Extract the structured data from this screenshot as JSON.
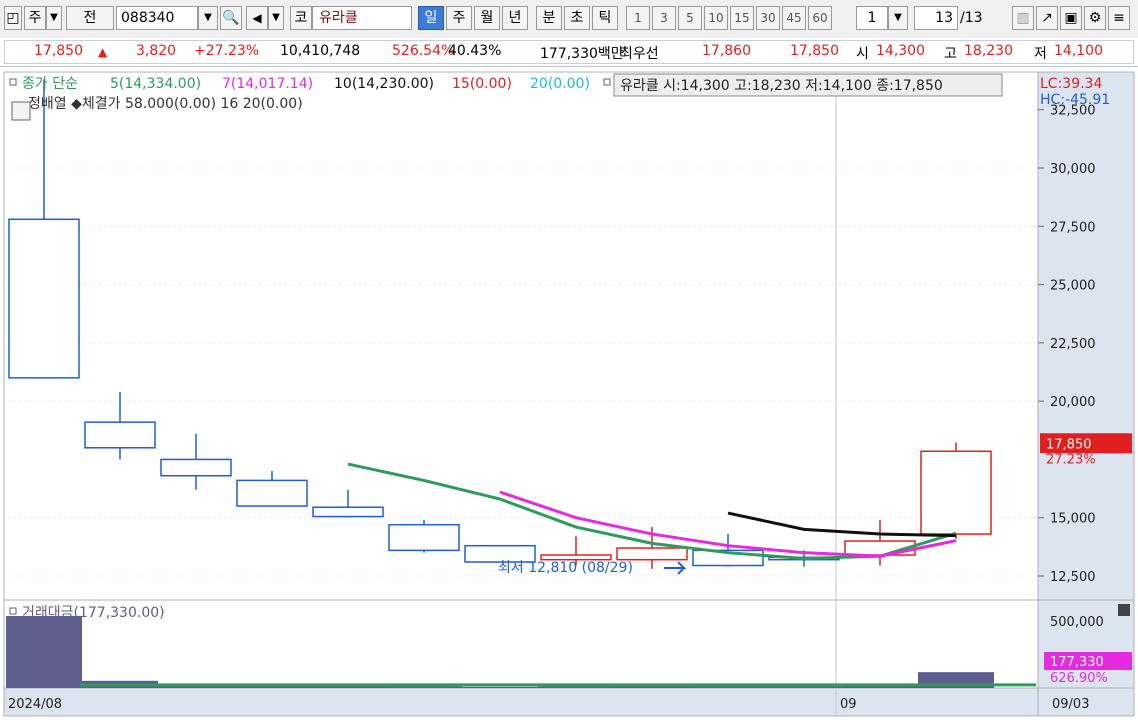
{
  "toolbar": {
    "market_label": "주",
    "prev_label": "전",
    "code": "088340",
    "kospi_label": "코",
    "stock_name": "유라클",
    "periods": [
      "일",
      "주",
      "월",
      "년",
      "분",
      "초",
      "틱"
    ],
    "active_period": "일",
    "minute_options": [
      "1",
      "3",
      "5",
      "10",
      "15",
      "30",
      "45",
      "60"
    ],
    "unit_value": "1",
    "page_indicator": "13",
    "page_total": "/13"
  },
  "info": {
    "price": "17,850",
    "change": "3,820",
    "change_pct": "+27.23%",
    "volume": "10,410,748",
    "volume_ratio": "526.54%",
    "turnover": "40.43%",
    "trade_value": "177,330백만",
    "best_bid_label": "최우선",
    "best_ask": "17,860",
    "best_bid": "17,850",
    "open_label": "시",
    "open": "14,300",
    "high_label": "고",
    "high": "18,230",
    "low_label": "저",
    "low": "14,100"
  },
  "legend": {
    "ma_label": "종가 단순",
    "ma5": "5(14,334.00)",
    "ma7": "7(14,017.14)",
    "ma10": "10(14,230.00)",
    "ma15": "15(0.00)",
    "ma20": "20(0.00)",
    "ohlc_box": "유라클 시:14,300 고:18,230 저:14,100 종:17,850",
    "overlay_text": "정배열 ◆체결가 58.000(0.00) 16 20(0.00)",
    "lc": "LC:39.34",
    "hc": "HC:-45.91",
    "low_marker": "최저 12,810 (08/29)"
  },
  "price_axis": {
    "ticks": [
      "30,000",
      "27,500",
      "25,000",
      "22,500",
      "20,000",
      "15,000",
      "12,500"
    ],
    "top_partial": "32,500",
    "current": "17,850",
    "current_pct": "27.23%"
  },
  "volume_panel": {
    "label": "거래대금(177,330.00)",
    "tick": "500,000",
    "current": "177,330",
    "current_pct": "626.90%"
  },
  "date_axis": {
    "start": "2024/08",
    "mid": "09",
    "end": "09/03"
  },
  "colors": {
    "up": "#e02020",
    "down": "#1d5fd0",
    "ma5": "#2e9a5c",
    "ma7": "#e52be0",
    "ma10": "#111111",
    "ma15": "#e02020",
    "ma20": "#1fb7e0",
    "vol": "#5e5e8f"
  },
  "chart_data": {
    "type": "candlestick",
    "candles": [
      {
        "o": 27800,
        "h": 33800,
        "l": 21000,
        "c": 21000
      },
      {
        "o": 19100,
        "h": 20400,
        "l": 17500,
        "c": 18000
      },
      {
        "o": 17500,
        "h": 18600,
        "l": 16200,
        "c": 16800
      },
      {
        "o": 16600,
        "h": 17000,
        "l": 15500,
        "c": 15500
      },
      {
        "o": 15450,
        "h": 16200,
        "l": 15000,
        "c": 15050
      },
      {
        "o": 14700,
        "h": 14900,
        "l": 13500,
        "c": 13600
      },
      {
        "o": 13800,
        "h": 13800,
        "l": 13100,
        "c": 13100
      },
      {
        "o": 13200,
        "h": 14200,
        "l": 12950,
        "c": 13400
      },
      {
        "o": 13200,
        "h": 14600,
        "l": 12810,
        "c": 13700
      },
      {
        "o": 13600,
        "h": 14300,
        "l": 12900,
        "c": 12950
      },
      {
        "o": 13300,
        "h": 13600,
        "l": 12900,
        "c": 13200
      },
      {
        "o": 13400,
        "h": 14900,
        "l": 12950,
        "c": 14000
      },
      {
        "o": 14300,
        "h": 18230,
        "l": 14100,
        "c": 17850
      }
    ],
    "ma5": [
      null,
      null,
      null,
      null,
      17300,
      16600,
      15800,
      14600,
      13900,
      13500,
      13250,
      13350,
      14334
    ],
    "ma7": [
      null,
      null,
      null,
      null,
      null,
      null,
      16100,
      15000,
      14300,
      13800,
      13500,
      13350,
      14017
    ],
    "ma10": [
      null,
      null,
      null,
      null,
      null,
      null,
      null,
      null,
      null,
      15200,
      14500,
      14300,
      14230
    ],
    "volume": [
      500000,
      50000,
      20000,
      15000,
      15000,
      12000,
      8000,
      12000,
      18000,
      12000,
      12000,
      22000,
      110000
    ],
    "vol_ma": [
      40000,
      40000,
      40000,
      40000,
      40000,
      40000,
      40000,
      40000,
      40000,
      40000,
      40000,
      40000,
      40000
    ],
    "ylim": [
      12000,
      33000
    ]
  }
}
